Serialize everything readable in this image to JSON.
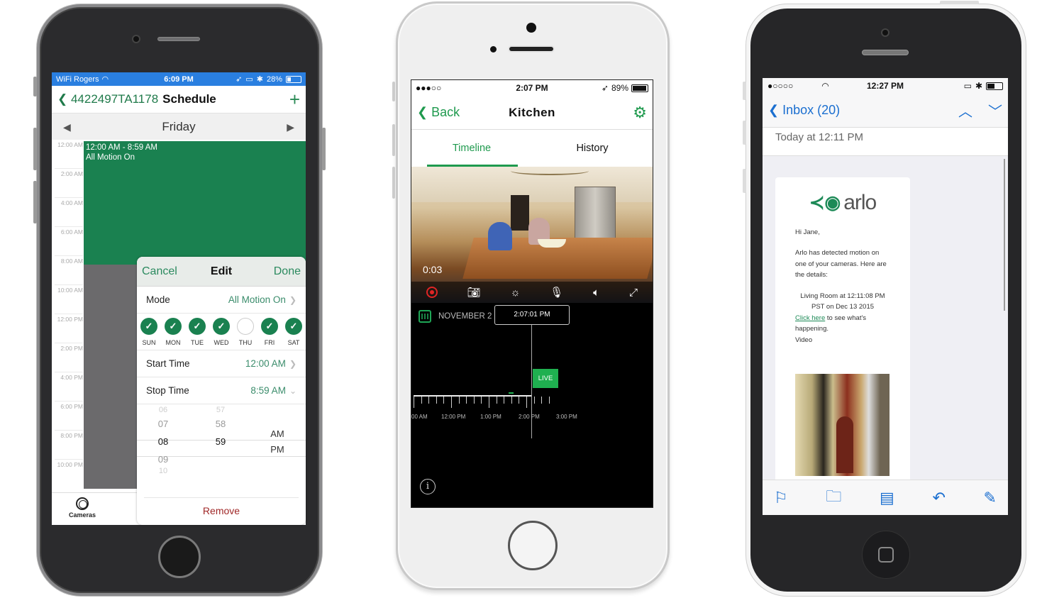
{
  "phone_schedule": {
    "status": {
      "carrier": "WiFi Rogers",
      "time": "6:09 PM",
      "battery": "28%",
      "battery_level": 0.28
    },
    "nav": {
      "back_label": "4422497TA1178",
      "title": "Schedule",
      "add_icon": "+"
    },
    "day": {
      "label": "Friday",
      "prev_icon": "◀",
      "next_icon": "▶"
    },
    "hours": [
      "12:00 AM",
      "2:00 AM",
      "4:00 AM",
      "6:00 AM",
      "8:00 AM",
      "10:00 AM",
      "12:00 PM",
      "2:00 PM",
      "4:00 PM",
      "6:00 PM",
      "8:00 PM",
      "10:00 PM"
    ],
    "event": {
      "time_range": "12:00 AM - 8:59 AM",
      "mode": "All Motion On",
      "color": "#1a8150"
    },
    "tabbar": {
      "cameras_label": "Cameras"
    },
    "edit_sheet": {
      "cancel_label": "Cancel",
      "title": "Edit",
      "done_label": "Done",
      "mode_label": "Mode",
      "mode_value": "All Motion On",
      "days": [
        {
          "label": "SUN",
          "checked": true
        },
        {
          "label": "MON",
          "checked": true
        },
        {
          "label": "TUE",
          "checked": true
        },
        {
          "label": "WED",
          "checked": true
        },
        {
          "label": "THU",
          "checked": false
        },
        {
          "label": "FRI",
          "checked": true
        },
        {
          "label": "SAT",
          "checked": true
        }
      ],
      "start_label": "Start Time",
      "start_value": "12:00 AM",
      "stop_label": "Stop Time",
      "stop_value": "8:59 AM",
      "picker": {
        "hours": [
          "06",
          "07",
          "08",
          "09",
          "10"
        ],
        "minutes": [
          "57",
          "58",
          "59"
        ],
        "ampm": [
          "AM",
          "PM"
        ],
        "selected_hour": "08",
        "selected_minute": "59",
        "selected_ampm": "AM"
      },
      "remove_label": "Remove"
    }
  },
  "phone_kitchen": {
    "status": {
      "signal": "●●●○○",
      "time": "2:07 PM",
      "battery": "89%",
      "battery_level": 0.89
    },
    "nav": {
      "back_label": "Back",
      "title": "Kitchen"
    },
    "tabs": [
      {
        "label": "Timeline",
        "active": true
      },
      {
        "label": "History",
        "active": false
      }
    ],
    "video": {
      "elapsed": "0:03"
    },
    "timeline": {
      "date": "NOVEMBER 2",
      "current_time": "2:07:01 PM",
      "live_label": "LIVE",
      "labels": [
        "00 AM",
        "12:00 PM",
        "1:00 PM",
        "2:00 PM",
        "3:00 PM"
      ]
    },
    "accent": "#1f9a4e"
  },
  "phone_mail": {
    "status": {
      "signal": "●○○○○",
      "time": "12:27 PM",
      "battery_level": 0.45
    },
    "nav": {
      "back_label": "Inbox (20)"
    },
    "date": "Today at 12:11 PM",
    "email": {
      "brand": "arlo",
      "greeting": "Hi Jane,",
      "intro": "Arlo has detected motion on one of your cameras. Here are the details:",
      "detail_line1": "Living Room at 12:11:08 PM",
      "detail_line2": "PST on Dec 13 2015",
      "link_text": "Click here",
      "link_rest": " to see what's happening.",
      "video_label": "Video"
    },
    "accent": "#1b6fd0"
  }
}
